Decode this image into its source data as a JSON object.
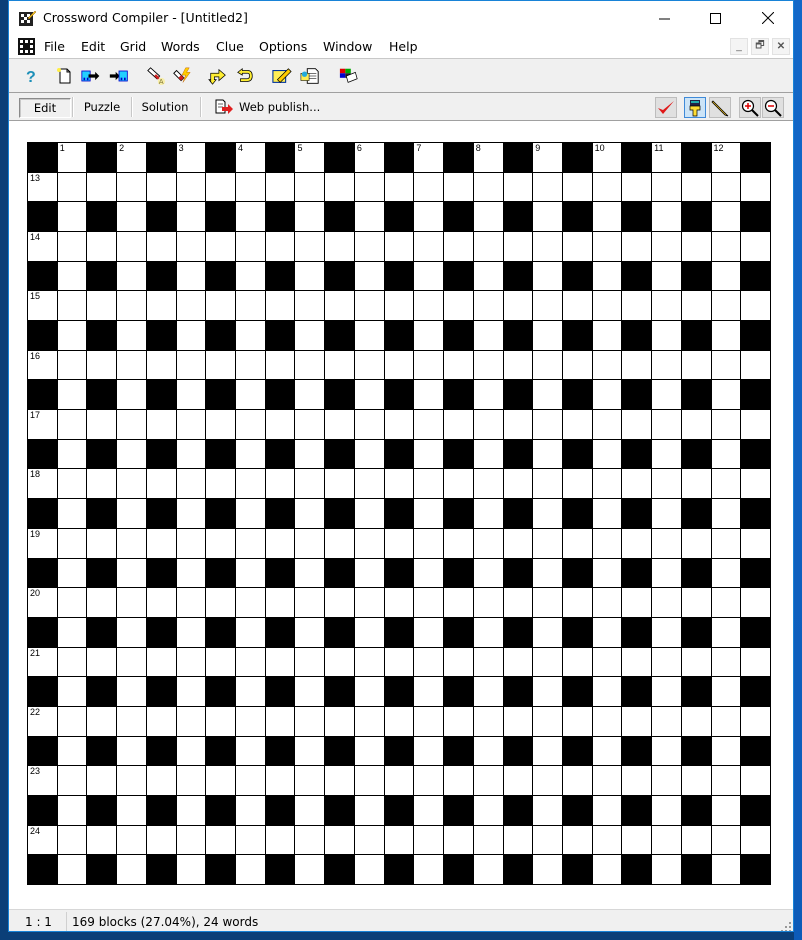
{
  "window": {
    "title": "Crossword Compiler - [Untitled2]",
    "controls": {
      "minimize": "minimize",
      "maximize": "maximize",
      "close": "close"
    }
  },
  "menubar": {
    "items": [
      "File",
      "Edit",
      "Grid",
      "Words",
      "Clue",
      "Options",
      "Window",
      "Help"
    ],
    "mdi_controls": [
      "minimize",
      "restore",
      "close"
    ]
  },
  "toolbar": {
    "icons": [
      "help-icon",
      "new-document-icon",
      "export-icon",
      "import-icon",
      "autofill-icon",
      "quick-fill-icon",
      "word-direction-icon",
      "undo-icon",
      "edit-clue-icon",
      "clue-database-icon",
      "color-icon"
    ]
  },
  "view_toolbar": {
    "tabs": [
      "Edit",
      "Puzzle",
      "Solution"
    ],
    "active_tab": "Edit",
    "web_publish_label": "Web publish...",
    "right_icons": [
      "check-icon",
      "paint-brush-icon",
      "pencil-icon",
      "zoom-in-icon",
      "zoom-out-icon"
    ]
  },
  "grid": {
    "size": 25,
    "pattern": "blocks at even row AND even column (0-indexed)",
    "across_numbers": [
      "1",
      "2",
      "3",
      "4",
      "5",
      "6",
      "7",
      "8",
      "9",
      "10",
      "11",
      "12"
    ],
    "down_numbers": [
      "13",
      "14",
      "15",
      "16",
      "17",
      "18",
      "19",
      "20",
      "21",
      "22",
      "23",
      "24"
    ]
  },
  "statusbar": {
    "position": "1 : 1",
    "summary": "169 blocks (27.04%), 24 words"
  }
}
